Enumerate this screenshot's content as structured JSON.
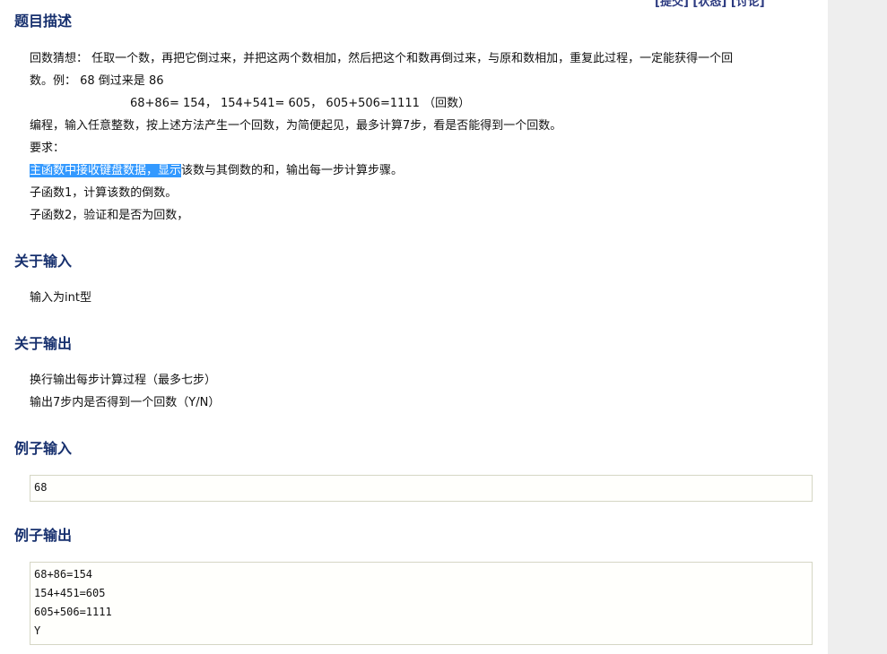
{
  "top_nav": {
    "text": "[提交] [状态] [讨论]"
  },
  "description": {
    "title": "题目描述",
    "lines": [
      "回数猜想：  任取一个数，再把它倒过来，并把这两个数相加，然后把这个和数再倒过来，与原和数相加，重复此过程，一定能获得一个回",
      "数。例：  68 倒过来是 86",
      "68+86= 154， 154+541= 605，  605+506=1111 （回数）",
      "编程，输入任意整数，按上述方法产生一个回数，为简便起见，最多计算7步，看是否能得到一个回数。",
      "要求："
    ],
    "highlighted": "主函数中接收键盘数据，显示",
    "after_highlight": "该数与其倒数的和，输出每一步计算步骤。",
    "sub1": "子函数1，计算该数的倒数。",
    "sub2": "子函数2，验证和是否为回数，"
  },
  "input_section": {
    "title": "关于输入",
    "text": "输入为int型"
  },
  "output_section": {
    "title": "关于输出",
    "line1": "换行输出每步计算过程（最多七步）",
    "line2": "输出7步内是否得到一个回数（Y/N）"
  },
  "sample_input": {
    "title": "例子输入",
    "content": "68"
  },
  "sample_output": {
    "title": "例子输出",
    "lines": [
      "68+86=154",
      "154+451=605",
      "605+506=1111",
      "Y"
    ]
  }
}
